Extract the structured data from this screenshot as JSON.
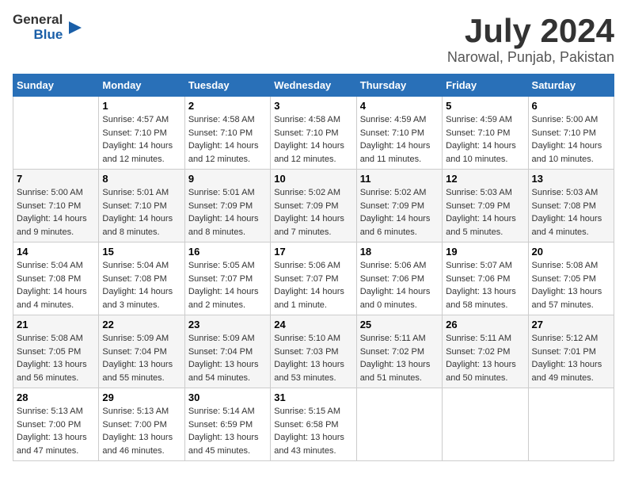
{
  "header": {
    "logo_general": "General",
    "logo_blue": "Blue",
    "title": "July 2024",
    "subtitle": "Narowal, Punjab, Pakistan"
  },
  "days_of_week": [
    "Sunday",
    "Monday",
    "Tuesday",
    "Wednesday",
    "Thursday",
    "Friday",
    "Saturday"
  ],
  "weeks": [
    [
      {
        "day": "",
        "info": ""
      },
      {
        "day": "1",
        "info": "Sunrise: 4:57 AM\nSunset: 7:10 PM\nDaylight: 14 hours\nand 12 minutes."
      },
      {
        "day": "2",
        "info": "Sunrise: 4:58 AM\nSunset: 7:10 PM\nDaylight: 14 hours\nand 12 minutes."
      },
      {
        "day": "3",
        "info": "Sunrise: 4:58 AM\nSunset: 7:10 PM\nDaylight: 14 hours\nand 12 minutes."
      },
      {
        "day": "4",
        "info": "Sunrise: 4:59 AM\nSunset: 7:10 PM\nDaylight: 14 hours\nand 11 minutes."
      },
      {
        "day": "5",
        "info": "Sunrise: 4:59 AM\nSunset: 7:10 PM\nDaylight: 14 hours\nand 10 minutes."
      },
      {
        "day": "6",
        "info": "Sunrise: 5:00 AM\nSunset: 7:10 PM\nDaylight: 14 hours\nand 10 minutes."
      }
    ],
    [
      {
        "day": "7",
        "info": "Sunrise: 5:00 AM\nSunset: 7:10 PM\nDaylight: 14 hours\nand 9 minutes."
      },
      {
        "day": "8",
        "info": "Sunrise: 5:01 AM\nSunset: 7:10 PM\nDaylight: 14 hours\nand 8 minutes."
      },
      {
        "day": "9",
        "info": "Sunrise: 5:01 AM\nSunset: 7:09 PM\nDaylight: 14 hours\nand 8 minutes."
      },
      {
        "day": "10",
        "info": "Sunrise: 5:02 AM\nSunset: 7:09 PM\nDaylight: 14 hours\nand 7 minutes."
      },
      {
        "day": "11",
        "info": "Sunrise: 5:02 AM\nSunset: 7:09 PM\nDaylight: 14 hours\nand 6 minutes."
      },
      {
        "day": "12",
        "info": "Sunrise: 5:03 AM\nSunset: 7:09 PM\nDaylight: 14 hours\nand 5 minutes."
      },
      {
        "day": "13",
        "info": "Sunrise: 5:03 AM\nSunset: 7:08 PM\nDaylight: 14 hours\nand 4 minutes."
      }
    ],
    [
      {
        "day": "14",
        "info": "Sunrise: 5:04 AM\nSunset: 7:08 PM\nDaylight: 14 hours\nand 4 minutes."
      },
      {
        "day": "15",
        "info": "Sunrise: 5:04 AM\nSunset: 7:08 PM\nDaylight: 14 hours\nand 3 minutes."
      },
      {
        "day": "16",
        "info": "Sunrise: 5:05 AM\nSunset: 7:07 PM\nDaylight: 14 hours\nand 2 minutes."
      },
      {
        "day": "17",
        "info": "Sunrise: 5:06 AM\nSunset: 7:07 PM\nDaylight: 14 hours\nand 1 minute."
      },
      {
        "day": "18",
        "info": "Sunrise: 5:06 AM\nSunset: 7:06 PM\nDaylight: 14 hours\nand 0 minutes."
      },
      {
        "day": "19",
        "info": "Sunrise: 5:07 AM\nSunset: 7:06 PM\nDaylight: 13 hours\nand 58 minutes."
      },
      {
        "day": "20",
        "info": "Sunrise: 5:08 AM\nSunset: 7:05 PM\nDaylight: 13 hours\nand 57 minutes."
      }
    ],
    [
      {
        "day": "21",
        "info": "Sunrise: 5:08 AM\nSunset: 7:05 PM\nDaylight: 13 hours\nand 56 minutes."
      },
      {
        "day": "22",
        "info": "Sunrise: 5:09 AM\nSunset: 7:04 PM\nDaylight: 13 hours\nand 55 minutes."
      },
      {
        "day": "23",
        "info": "Sunrise: 5:09 AM\nSunset: 7:04 PM\nDaylight: 13 hours\nand 54 minutes."
      },
      {
        "day": "24",
        "info": "Sunrise: 5:10 AM\nSunset: 7:03 PM\nDaylight: 13 hours\nand 53 minutes."
      },
      {
        "day": "25",
        "info": "Sunrise: 5:11 AM\nSunset: 7:02 PM\nDaylight: 13 hours\nand 51 minutes."
      },
      {
        "day": "26",
        "info": "Sunrise: 5:11 AM\nSunset: 7:02 PM\nDaylight: 13 hours\nand 50 minutes."
      },
      {
        "day": "27",
        "info": "Sunrise: 5:12 AM\nSunset: 7:01 PM\nDaylight: 13 hours\nand 49 minutes."
      }
    ],
    [
      {
        "day": "28",
        "info": "Sunrise: 5:13 AM\nSunset: 7:00 PM\nDaylight: 13 hours\nand 47 minutes."
      },
      {
        "day": "29",
        "info": "Sunrise: 5:13 AM\nSunset: 7:00 PM\nDaylight: 13 hours\nand 46 minutes."
      },
      {
        "day": "30",
        "info": "Sunrise: 5:14 AM\nSunset: 6:59 PM\nDaylight: 13 hours\nand 45 minutes."
      },
      {
        "day": "31",
        "info": "Sunrise: 5:15 AM\nSunset: 6:58 PM\nDaylight: 13 hours\nand 43 minutes."
      },
      {
        "day": "",
        "info": ""
      },
      {
        "day": "",
        "info": ""
      },
      {
        "day": "",
        "info": ""
      }
    ]
  ]
}
